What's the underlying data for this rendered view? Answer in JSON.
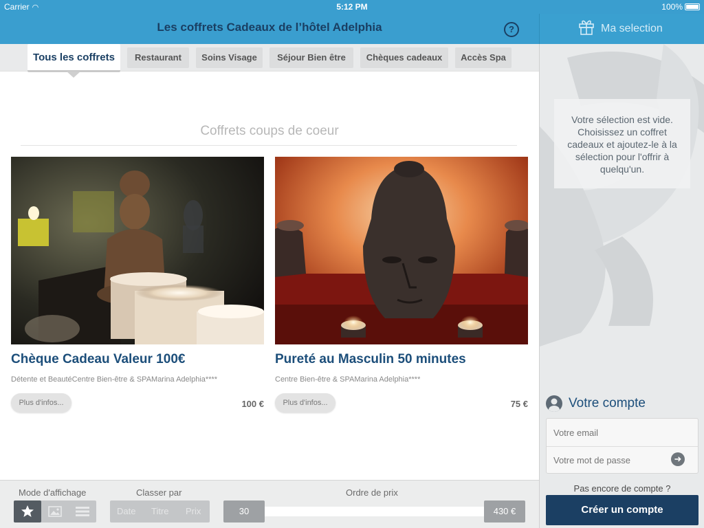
{
  "status_bar": {
    "carrier": "Carrier",
    "time": "5:12 PM",
    "battery": "100%"
  },
  "header": {
    "title": "Les coffrets Cadeaux de l’hôtel Adelphia",
    "help": "?"
  },
  "selection": {
    "title": "Ma selection",
    "empty_message": "Votre sélection est vide. Choisissez un coffret cadeaux et ajoutez-le à la sélection pour l'offrir à quelqu'un."
  },
  "tabs": [
    {
      "label": "Tous les coffrets",
      "active": true
    },
    {
      "label": "Restaurant"
    },
    {
      "label": "Soins Visage"
    },
    {
      "label": "Séjour Bien être"
    },
    {
      "label": "Chèques cadeaux"
    },
    {
      "label": "Accès Spa"
    }
  ],
  "section_title": "Coffrets coups de coeur",
  "products": [
    {
      "title": "Chèque Cadeau Valeur 100€",
      "subtitle": "Détente et BeautéCentre Bien-être & SPAMarina Adelphia****",
      "info_label": "Plus d'infos...",
      "price": "100 €"
    },
    {
      "title": "Pureté au Masculin 50 minutes",
      "subtitle": "Centre Bien-être & SPAMarina Adelphia****",
      "info_label": "Plus d'infos...",
      "price": "75 €"
    }
  ],
  "toolbar": {
    "display_mode_label": "Mode d'affichage",
    "display_modes": [
      "star-icon",
      "image-icon",
      "list-icon"
    ],
    "sort_label": "Classer par",
    "sort_options": [
      "Date",
      "Titre",
      "Prix"
    ],
    "price_order_label": "Ordre de prix",
    "price_min": "30",
    "price_max": "430 €"
  },
  "account": {
    "title": "Votre compte",
    "email_placeholder": "Votre email",
    "password_placeholder": "Votre mot de passe",
    "no_account": "Pas encore de compte ?",
    "create_label": "Créer un compte"
  },
  "colors": {
    "header_blue": "#3a9ecf",
    "title_navy": "#1a3f63",
    "product_title": "#1c4e7a",
    "create_button": "#1b3f63"
  }
}
